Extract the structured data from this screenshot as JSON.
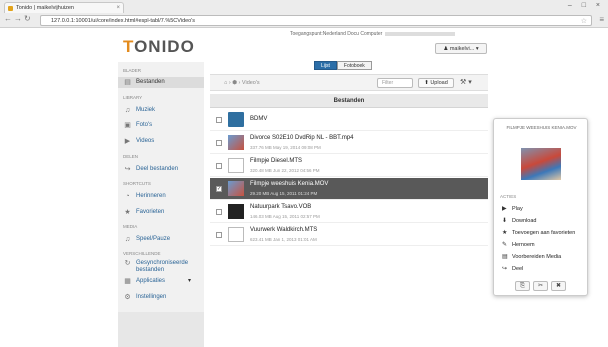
{
  "browser": {
    "tab_title": "Tonido | maikelvijhuizen",
    "url": "127.0.0.1:10001/ui/core/index.html#espl-tabl/7.%5CVideo's"
  },
  "header": {
    "logo_prefix": "T",
    "logo_rest": "ONIDO",
    "company_label": "Toegangspunt:Nederland Docu Computer",
    "user_label": "♟ maikelvi... ▾"
  },
  "sidebar": {
    "sections": {
      "blader": "BLADER",
      "library": "LIBRARY",
      "delen": "DELEN",
      "shortcuts": "SHORTCUTS",
      "media": "MEDIA",
      "verschillende": "VERSCHILLENDE"
    },
    "items": [
      {
        "label": "Bestanden",
        "icon": "▤"
      },
      {
        "label": "Muziek",
        "icon": "♫"
      },
      {
        "label": "Foto's",
        "icon": "▣"
      },
      {
        "label": "Videos",
        "icon": "▶"
      },
      {
        "label": "Deel bestanden",
        "icon": "↪"
      },
      {
        "label": "Herinneren",
        "icon": "◔"
      },
      {
        "label": "Favorieten",
        "icon": "★"
      },
      {
        "label": "Speel/Pauze",
        "icon": "♫"
      },
      {
        "label": "Gesynchroniseerde bestanden",
        "icon": "↻"
      },
      {
        "label": "Applicaties",
        "icon": "▦"
      },
      {
        "label": "Instellingen",
        "icon": "⚙"
      }
    ]
  },
  "view_toggle": {
    "list": "Lijst",
    "photobook": "Fotoboek"
  },
  "toolbar": {
    "breadcrumb": "⌂ › ⬢ › Video's",
    "filter_placeholder": "Filter",
    "upload_label": "⬆ Upload",
    "tools_label": "⚒ ▾"
  },
  "table": {
    "header": "Bestanden",
    "rows": [
      {
        "name": "BDMV",
        "meta": "",
        "thumb": "folder",
        "checked": false
      },
      {
        "name": "Divorce S02E10 DvdRip NL - BBT.mp4",
        "meta": "337.76 MB      May 19, 2014 09:08 PM",
        "thumb": "img",
        "checked": false
      },
      {
        "name": "Filmpje Diesel.MTS",
        "meta": "320.48 MB      Jun 22, 2012 04:56 PM",
        "thumb": "doc",
        "checked": false
      },
      {
        "name": "Filmpje weeshuis Kenia.MOV",
        "meta": "29.20 MB      Aug 15, 2011 01:24 PM",
        "thumb": "img",
        "checked": true
      },
      {
        "name": "Natuurpark Tsavo.VOB",
        "meta": "146.03 MB      Aug 15, 2011 02:57 PM",
        "thumb": "cam",
        "checked": false
      },
      {
        "name": "Vuurwerk Waldkirch.MTS",
        "meta": "623.41 MB      Jan 1, 2013 01:01 AM",
        "thumb": "doc",
        "checked": false
      }
    ]
  },
  "panel": {
    "title": "FILMPJE WEESHUIS KENIA.MOV",
    "acties_label": "ACTIES",
    "actions": [
      {
        "label": "Play",
        "icon": "▶"
      },
      {
        "label": "Download",
        "icon": "⬇"
      },
      {
        "label": "Toevoegen aan favorieten",
        "icon": "★"
      },
      {
        "label": "Hernoem",
        "icon": "✎"
      },
      {
        "label": "Voorbereiden Media",
        "icon": "▤"
      },
      {
        "label": "Deel",
        "icon": "↪"
      }
    ],
    "buttons": {
      "copy": "⎘",
      "cut": "✂",
      "delete": "✖"
    }
  }
}
